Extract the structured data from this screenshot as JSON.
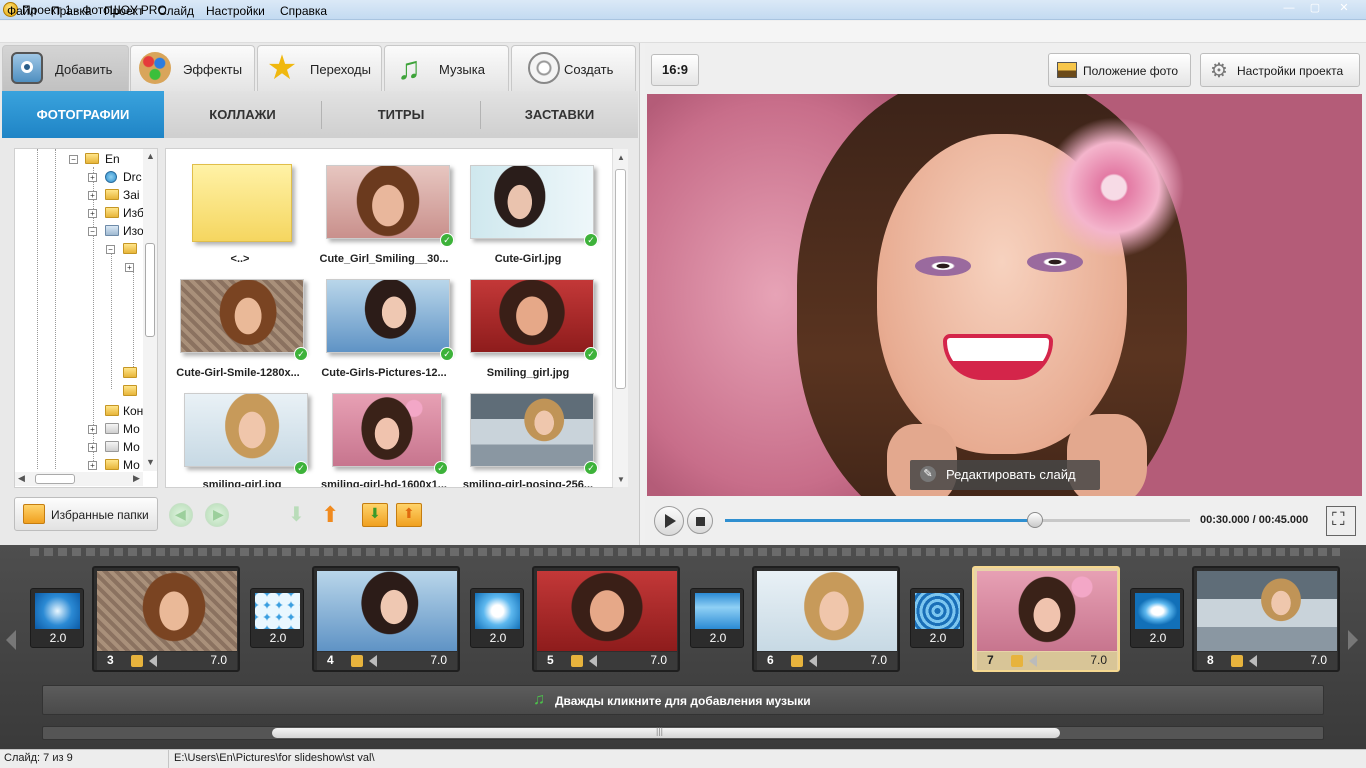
{
  "window": {
    "title": "Проект 1 - ФотоШОУ PRO",
    "min": "—",
    "max": "▢",
    "close": "✕"
  },
  "menu": [
    "Файл",
    "Правка",
    "Проект",
    "Слайд",
    "Настройки",
    "Справка"
  ],
  "main_tabs": [
    {
      "label": "Добавить",
      "icon": "camera-icon",
      "active": true
    },
    {
      "label": "Эффекты",
      "icon": "palette-icon"
    },
    {
      "label": "Переходы",
      "icon": "star-icon"
    },
    {
      "label": "Музыка",
      "icon": "music-note-icon"
    },
    {
      "label": "Создать",
      "icon": "film-reel-icon"
    }
  ],
  "sub_tabs": [
    "ФОТОГРАФИИ",
    "КОЛЛАЖИ",
    "ТИТРЫ",
    "ЗАСТАВКИ"
  ],
  "tree": {
    "root": "En",
    "items": [
      "Drc",
      "Заі",
      "Изб",
      "Изо",
      "Кон",
      "Мо",
      "Мо",
      "Мо"
    ]
  },
  "thumbnails": [
    {
      "caption": "<..>",
      "kind": "folder",
      "checked": false
    },
    {
      "caption": "Cute_Girl_Smiling__30...",
      "checked": true
    },
    {
      "caption": "Cute-Girl.jpg",
      "checked": true
    },
    {
      "caption": "Cute-Girl-Smile-1280x...",
      "checked": true
    },
    {
      "caption": "Cute-Girls-Pictures-12...",
      "checked": true
    },
    {
      "caption": "Smiling_girl.jpg",
      "checked": true
    },
    {
      "caption": "smiling-girl.jpg",
      "checked": true
    },
    {
      "caption": "smiling-girl-hd-1600x1...",
      "checked": true
    },
    {
      "caption": "smiling-girl-posing-256...",
      "checked": true
    }
  ],
  "toolbar": {
    "favorites_label": "Избранные папки"
  },
  "preview": {
    "ratio": "16:9",
    "photo_position_label": "Положение фото",
    "project_settings_label": "Настройки проекта",
    "edit_slide_label": "Редактировать слайд",
    "time": "00:30.000 / 00:45.000",
    "progress": 0.667
  },
  "timeline": {
    "transitions": [
      "2.0",
      "2.0",
      "2.0",
      "2.0",
      "2.0",
      "2.0"
    ],
    "slides": [
      {
        "num": "3",
        "dur": "7.0"
      },
      {
        "num": "4",
        "dur": "7.0"
      },
      {
        "num": "5",
        "dur": "7.0"
      },
      {
        "num": "6",
        "dur": "7.0"
      },
      {
        "num": "7",
        "dur": "7.0",
        "selected": true
      },
      {
        "num": "8",
        "dur": "7.0"
      }
    ],
    "music_hint": "Дважды кликните для добавления музыки",
    "scroll_grip": "|||"
  },
  "status": {
    "slide": "Слайд: 7 из 9",
    "path": "E:\\Users\\En\\Pictures\\for slideshow\\st val\\"
  },
  "colors": {
    "accent": "#2f8fd0",
    "selected_slide": "#f5d890",
    "check": "#3db23a"
  }
}
